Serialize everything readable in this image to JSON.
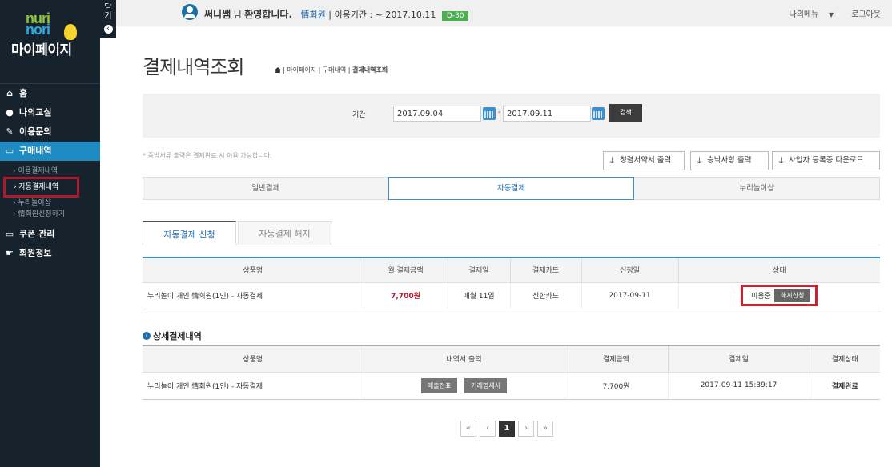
{
  "sidebar": {
    "close_label": "닫기",
    "close_label_top": "닫",
    "close_label_bottom": "기",
    "logo_line1": "nuri",
    "logo_line2": "nori",
    "title": "마이페이지",
    "menu": [
      {
        "label": "홈",
        "icon": "home-icon"
      },
      {
        "label": "나의교실",
        "icon": "user-icon"
      },
      {
        "label": "이용문의",
        "icon": "edit-icon"
      },
      {
        "label": "구매내역",
        "icon": "cart-icon"
      }
    ],
    "submenu": [
      {
        "label": "이용결제내역"
      },
      {
        "label": "자동결제내역"
      },
      {
        "label": "누리놀이샵"
      },
      {
        "label": "情회원신청하기"
      }
    ],
    "menu2": [
      {
        "label": "쿠폰 관리",
        "icon": "coupon-icon"
      },
      {
        "label": "회원정보",
        "icon": "hand-icon"
      }
    ]
  },
  "topbar": {
    "username": "써니쌤",
    "honorific": "님",
    "welcome": "환영합니다.",
    "grade": "情회원",
    "period": "| 이용기간 : ~ 2017.10.11",
    "dday": "D-30",
    "my_menu": "나의메뉴",
    "dropdown": "▼",
    "logout": "로그아웃"
  },
  "page": {
    "title": "결제내역조회",
    "breadcrumb": "| 마이페이지 | 구매내역 |",
    "breadcrumb_current": "결제내역조회"
  },
  "search": {
    "period_label": "기간",
    "start_date": "2017.09.04",
    "end_date": "2017.09.11",
    "separator": "-",
    "button": "검색"
  },
  "note": "* 증빙서류 출력은 결제완료 시 이용 가능합니다.",
  "downloads": [
    {
      "label": "청렴서약서 출력"
    },
    {
      "label": "승낙사항 출력"
    },
    {
      "label": "사업자 등록증 다운로드"
    }
  ],
  "main_tabs": [
    {
      "label": "일반결제"
    },
    {
      "label": "자동결제"
    },
    {
      "label": "누리놀이샵"
    }
  ],
  "sub_tabs": [
    {
      "label": "자동결제 신청"
    },
    {
      "label": "자동결제 해지"
    }
  ],
  "auto_table": {
    "headers": [
      "상품명",
      "월 결제금액",
      "결제일",
      "결제카드",
      "신청일",
      "상태"
    ],
    "row": {
      "product": "누리놀이 개인 情회원(1인) - 자동결제",
      "amount": "7,700원",
      "pay_day": "매월 11일",
      "card": "신한카드",
      "apply_date": "2017-09-11",
      "status": "이용중",
      "cancel": "해지신청"
    }
  },
  "detail": {
    "title": "상세결제내역",
    "icon": "›",
    "headers": [
      "상품명",
      "내역서 출력",
      "결제금액",
      "결제일",
      "결제상태"
    ],
    "row": {
      "product": "누리놀이 개인 情회원(1인) - 자동결제",
      "btn1": "매출전표",
      "btn2": "거래명세서",
      "amount": "7,700원",
      "date": "2017-09-11 15:39:17",
      "status": "결제완료"
    }
  },
  "pager": {
    "first": "«",
    "prev": "‹",
    "page": "1",
    "next": "›",
    "last": "»"
  }
}
